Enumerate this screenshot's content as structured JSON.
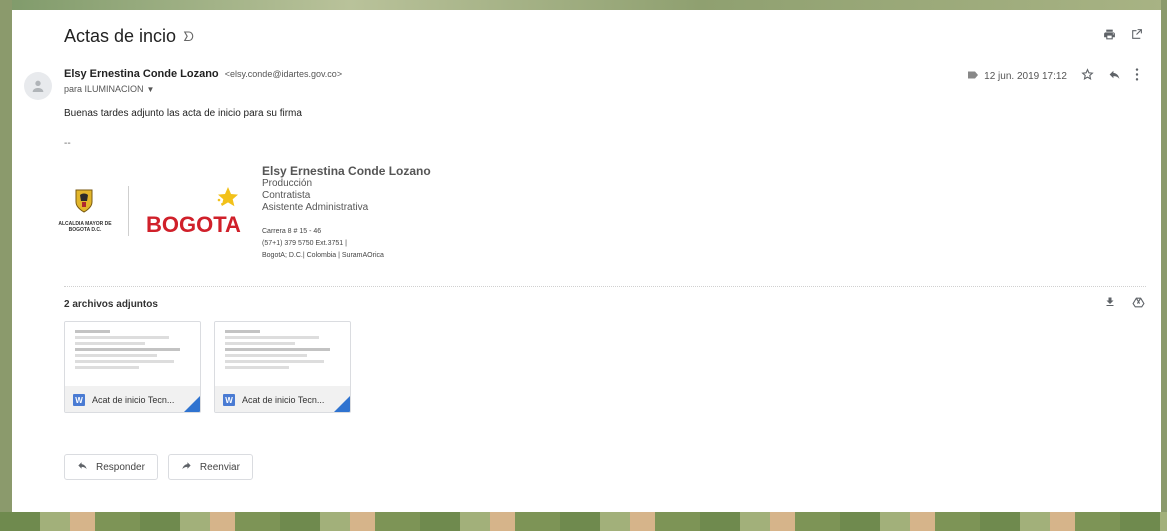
{
  "email": {
    "subject": "Actas de incio",
    "sender_name": "Elsy Ernestina Conde Lozano",
    "sender_email": "<elsy.conde@idartes.gov.co>",
    "to_line": "para ILUMINACION",
    "date": "12 jun. 2019 17:12",
    "body": "Buenas tardes adjunto las acta de inicio para su firma",
    "dash": "--"
  },
  "signature": {
    "logo_bogota": "BOGOTA",
    "logo_alcaldia": "ALCALDIA MAYOR DE BOGOTA D.C.",
    "name": "Elsy Ernestina Conde Lozano",
    "line1": "Producción",
    "line2": "Contratista",
    "line3": "Asistente Administrativa",
    "address": "Carrera 8 # 15 - 46",
    "phone": "(57+1) 379 5750 Ext.3751 |",
    "city": "BogotA; D.C.| Colombia | SuramAOrica"
  },
  "attachments": {
    "title": "2 archivos adjuntos",
    "files": [
      {
        "name": "Acat de inicio Tecn..."
      },
      {
        "name": "Acat de inicio Tecn..."
      }
    ]
  },
  "actions": {
    "reply": "Responder",
    "forward": "Reenviar"
  },
  "icons": {
    "subject_icon": "snooze-label-icon",
    "print": "print-icon",
    "open_new": "open-new-window-icon",
    "label": "label-icon",
    "star": "star-icon",
    "reply": "reply-icon",
    "more": "more-vert-icon",
    "download": "download-icon",
    "drive": "save-to-drive-icon"
  },
  "colors": {
    "accent_blue": "#2f73d0",
    "bogota_red": "#d0202a"
  }
}
